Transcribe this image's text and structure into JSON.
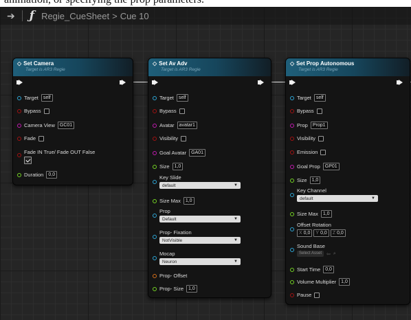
{
  "caption": "animation, or specifying the prop parameters.",
  "topbar": {
    "back_arrow": "➔",
    "function_glyph": "ƒ",
    "crumb_parent": "Regie_CueSheet",
    "crumb_sep": ">",
    "crumb_current": "Cue 10"
  },
  "nodes": {
    "camera": {
      "title": "Set Camera",
      "subtitle": "Target is AR3 Regie",
      "target_label": "Target",
      "target_value": "self",
      "bypass_label": "Bypass",
      "camera_view_label": "Camera View",
      "camera_view_value": "GC01",
      "fade_label": "Fade",
      "fade_in_label": "Fade IN True/ Fade OUT False",
      "duration_label": "Duration",
      "duration_value": "0,0"
    },
    "avadv": {
      "title": "Set Av Adv",
      "subtitle": "Target is AR3 Regie",
      "target_label": "Target",
      "target_value": "self",
      "bypass_label": "Bypass",
      "avatar_label": "Avatar",
      "avatar_value": "avatar1",
      "visibility_label": "Visibility",
      "goal_avatar_label": "Goal Avatar",
      "goal_avatar_value": "GA01",
      "size_label": "Size",
      "size_value": "1,0",
      "key_slide_label": "Key Slide",
      "key_slide_value": "default",
      "size_max_label": "Size Max",
      "size_max_value": "1,0",
      "prop_label": "Prop",
      "prop_value": "Default",
      "prop_fixation_label": "Prop- Fixation",
      "prop_fixation_value": "NotVisible",
      "mocap_label": "Mocap",
      "mocap_value": "Neuron",
      "prop_offset_label": "Prop- Offset",
      "prop_size_label": "Prop- Size",
      "prop_size_value": "1,0"
    },
    "prop": {
      "title": "Set Prop Autonomous",
      "subtitle": "Target is AR3 Regie",
      "target_label": "Target",
      "target_value": "self",
      "bypass_label": "Bypass",
      "prop_label": "Prop",
      "prop_value": "Prop1",
      "visibility_label": "Visibility",
      "emission_label": "Emission",
      "goal_prop_label": "Goal Prop",
      "goal_prop_value": "GP01",
      "size_label": "Size",
      "size_value": "1,0",
      "key_channel_label": "Key Channel",
      "key_channel_value": "default",
      "size_max_label": "Size Max",
      "size_max_value": "1,0",
      "offset_rotation_label": "Offset Rotation",
      "offset_x_axis": "X",
      "offset_x": "0,0",
      "offset_y_axis": "Y",
      "offset_y": "0,0",
      "offset_z_axis": "Z",
      "offset_z": "0,0",
      "sound_base_label": "Sound Base",
      "sound_base_value": "Select Asset",
      "start_time_label": "Start Time",
      "start_time_value": "0,0",
      "volume_multiplier_label": "Volume Multiplier",
      "volume_multiplier_value": "1,0",
      "pause_label": "Pause"
    }
  },
  "colors": {
    "pin_object": "#2ea6d6",
    "pin_bool": "#a31212",
    "pin_name": "#c21ab0",
    "pin_float": "#75d424",
    "pin_struct": "#d8701a",
    "header": "#1f5f7a"
  },
  "icons": [
    "back-arrow-icon",
    "function-icon",
    "diamond-icon",
    "exec-pin-icon",
    "dropdown-caret-icon",
    "browse-icon",
    "search-icon"
  ]
}
